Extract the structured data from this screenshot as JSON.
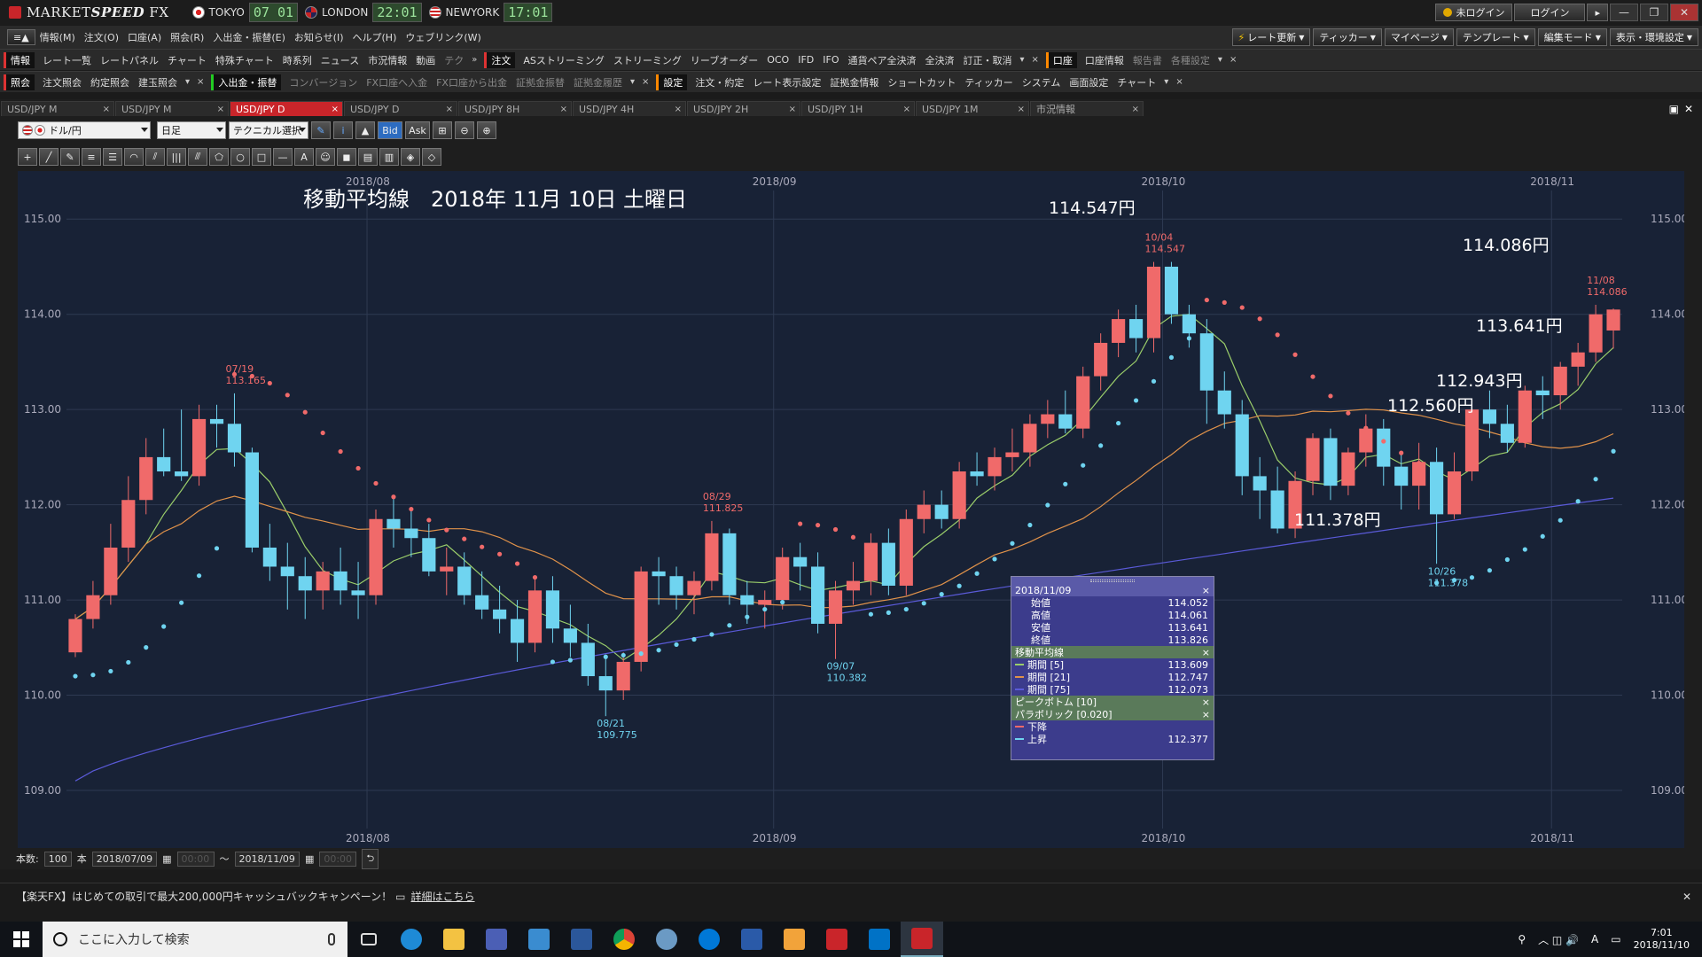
{
  "titlebar": {
    "app_name_prefix": "MARKET",
    "app_name_italic": "SPEED",
    "app_name_suffix": " FX",
    "clocks": [
      {
        "city": "TOKYO",
        "time": "07 01",
        "flag": "jp"
      },
      {
        "city": "LONDON",
        "time": "22:01",
        "flag": "uk"
      },
      {
        "city": "NEWYORK",
        "time": "17:01",
        "flag": "us"
      }
    ],
    "login_status": "未ログイン",
    "login_button": "ログイン",
    "next_arrow": "▸",
    "minimize": "—",
    "restore": "❐",
    "close": "✕"
  },
  "menubar": {
    "menu_icon": "≡▲",
    "items": [
      "情報(M)",
      "注文(O)",
      "口座(A)",
      "照会(R)",
      "入出金・振替(E)",
      "お知らせ(I)",
      "ヘルプ(H)",
      "ウェブリンク(W)"
    ],
    "right_buttons": [
      "レート更新",
      "ティッカー",
      "マイページ",
      "テンプレート",
      "編集モード",
      "表示・環境設定"
    ]
  },
  "toolrow1": {
    "info_label": "情報",
    "info_items": [
      "レート一覧",
      "レートパネル",
      "チャート",
      "特殊チャート",
      "時系列",
      "ニュース",
      "市況情報",
      "動画",
      "テク"
    ],
    "more_glyph": "»",
    "order_label": "注文",
    "order_items": [
      "ASストリーミング",
      "ストリーミング",
      "リーブオーダー",
      "OCO",
      "IFD",
      "IFO",
      "通貨ペア全決済",
      "全決済",
      "訂正・取消"
    ],
    "account_label": "口座",
    "account_items": [
      "口座情報",
      "報告書",
      "各種設定"
    ],
    "dropdown_glyph": "▾",
    "close_glyph": "×"
  },
  "toolrow2": {
    "inquiry_label": "照会",
    "inquiry_items": [
      "注文照会",
      "約定照会",
      "建玉照会"
    ],
    "transfer_label": "入出金・振替",
    "transfer_items": [
      "コンバージョン",
      "FX口座へ入金",
      "FX口座から出金",
      "証拠金振替",
      "証拠金履歴"
    ],
    "settings_label": "設定",
    "settings_items": [
      "注文・約定",
      "レート表示設定",
      "証拠金情報",
      "ショートカット",
      "ティッカー",
      "システム",
      "画面設定",
      "チャート"
    ],
    "dropdown_glyph": "▾",
    "close_glyph": "×"
  },
  "tabs": [
    {
      "label": "USD/JPY M",
      "active": false
    },
    {
      "label": "USD/JPY M",
      "active": false
    },
    {
      "label": "USD/JPY D",
      "active": true
    },
    {
      "label": "USD/JPY D",
      "active": false
    },
    {
      "label": "USD/JPY 8H",
      "active": false
    },
    {
      "label": "USD/JPY 4H",
      "active": false
    },
    {
      "label": "USD/JPY 2H",
      "active": false
    },
    {
      "label": "USD/JPY 1H",
      "active": false
    },
    {
      "label": "USD/JPY 1M",
      "active": false
    },
    {
      "label": "市況情報",
      "active": false
    }
  ],
  "tab_close": "×",
  "window_controls": {
    "maximize": "▣",
    "close": "✕"
  },
  "controls": {
    "pair": "ドル/円",
    "period": "日足",
    "technical": "テクニカル選択",
    "bid": "Bid",
    "ask": "Ask",
    "glyphs": {
      "pen": "✎",
      "info": "i",
      "mountain": "▲",
      "chart": "⊞",
      "zoom_out": "⊖",
      "zoom_in": "⊕"
    }
  },
  "drawing_tools": {
    "glyphs": [
      "+",
      "╱",
      "✎",
      "≡",
      "☰",
      "◠",
      "⫽",
      "|||",
      "⫻",
      "⬠",
      "○",
      "□",
      "—",
      "A",
      "☺",
      "◼",
      "▤",
      "▥",
      "◈",
      "◇"
    ]
  },
  "chart_overlay": {
    "title": "移動平均線　2018年 11月 10日 土曜日",
    "annotations": [
      "114.547円",
      "114.086円",
      "113.641円",
      "112.943円",
      "112.560円",
      "111.378円"
    ]
  },
  "chart_data": {
    "type": "candlestick",
    "symbol": "USD/JPY",
    "timeframe": "日足",
    "x_tick_labels": [
      "2018/08",
      "2018/09",
      "2018/10",
      "2018/11"
    ],
    "ylim": [
      108.6,
      115.3
    ],
    "y_ticks": [
      "115.00",
      "114.00",
      "113.00",
      "112.00",
      "111.00",
      "110.00",
      "109.00"
    ],
    "grid": true,
    "colors": {
      "up": "#f06a6a",
      "down": "#6fd4f0",
      "ma5": "#9acd6a",
      "ma21": "#e0924a",
      "ma75": "#5a5ad8",
      "sar_down": "#f06a6a",
      "sar_up": "#6fd4f0",
      "bg": "#182236"
    },
    "candles": [
      [
        110.45,
        110.85,
        110.4,
        110.8
      ],
      [
        110.8,
        111.2,
        110.7,
        111.05
      ],
      [
        111.05,
        111.8,
        110.95,
        111.55
      ],
      [
        111.55,
        112.3,
        111.4,
        112.05
      ],
      [
        112.05,
        112.7,
        111.9,
        112.5
      ],
      [
        112.5,
        112.8,
        112.3,
        112.35
      ],
      [
        112.35,
        113.0,
        112.25,
        112.3
      ],
      [
        112.3,
        113.05,
        112.2,
        112.9
      ],
      [
        112.9,
        113.05,
        112.6,
        112.85
      ],
      [
        112.85,
        113.17,
        112.4,
        112.55
      ],
      [
        112.55,
        112.6,
        111.5,
        111.55
      ],
      [
        111.55,
        111.8,
        111.2,
        111.35
      ],
      [
        111.35,
        111.6,
        110.9,
        111.25
      ],
      [
        111.25,
        111.45,
        110.8,
        111.1
      ],
      [
        111.1,
        111.4,
        110.9,
        111.3
      ],
      [
        111.3,
        111.55,
        110.95,
        111.1
      ],
      [
        111.1,
        111.4,
        110.8,
        111.05
      ],
      [
        111.05,
        111.95,
        110.95,
        111.85
      ],
      [
        111.85,
        112.1,
        111.55,
        111.75
      ],
      [
        111.75,
        111.95,
        111.45,
        111.65
      ],
      [
        111.65,
        111.8,
        111.25,
        111.3
      ],
      [
        111.3,
        111.55,
        111.05,
        111.35
      ],
      [
        111.35,
        111.5,
        110.95,
        111.05
      ],
      [
        111.05,
        111.3,
        110.8,
        110.9
      ],
      [
        110.9,
        111.15,
        110.65,
        110.8
      ],
      [
        110.8,
        111.0,
        110.35,
        110.55
      ],
      [
        110.55,
        111.25,
        110.45,
        111.1
      ],
      [
        111.1,
        111.25,
        110.55,
        110.7
      ],
      [
        110.7,
        110.95,
        110.4,
        110.55
      ],
      [
        110.55,
        110.75,
        110.1,
        110.2
      ],
      [
        110.2,
        110.4,
        109.78,
        110.05
      ],
      [
        110.05,
        110.45,
        109.95,
        110.35
      ],
      [
        110.35,
        111.35,
        110.25,
        111.3
      ],
      [
        111.3,
        111.45,
        110.95,
        111.25
      ],
      [
        111.25,
        111.35,
        110.9,
        111.05
      ],
      [
        111.05,
        111.3,
        110.85,
        111.2
      ],
      [
        111.2,
        111.83,
        111.1,
        111.7
      ],
      [
        111.7,
        111.75,
        110.95,
        111.05
      ],
      [
        111.05,
        111.2,
        110.75,
        110.95
      ],
      [
        110.95,
        111.1,
        110.7,
        111.0
      ],
      [
        111.0,
        111.55,
        110.9,
        111.45
      ],
      [
        111.45,
        111.6,
        111.1,
        111.35
      ],
      [
        111.35,
        111.5,
        110.65,
        110.75
      ],
      [
        110.75,
        111.2,
        110.38,
        111.1
      ],
      [
        111.1,
        111.4,
        110.95,
        111.2
      ],
      [
        111.2,
        111.7,
        111.05,
        111.6
      ],
      [
        111.6,
        111.75,
        111.05,
        111.15
      ],
      [
        111.15,
        111.95,
        111.05,
        111.85
      ],
      [
        111.85,
        112.15,
        111.7,
        112.0
      ],
      [
        112.0,
        112.15,
        111.75,
        111.85
      ],
      [
        111.85,
        112.45,
        111.75,
        112.35
      ],
      [
        112.35,
        112.55,
        112.2,
        112.3
      ],
      [
        112.3,
        112.6,
        112.15,
        112.5
      ],
      [
        112.5,
        112.8,
        112.35,
        112.55
      ],
      [
        112.55,
        112.95,
        112.4,
        112.85
      ],
      [
        112.85,
        113.1,
        112.7,
        112.95
      ],
      [
        112.95,
        113.2,
        112.75,
        112.8
      ],
      [
        112.8,
        113.45,
        112.7,
        113.35
      ],
      [
        113.35,
        113.8,
        113.2,
        113.7
      ],
      [
        113.7,
        114.05,
        113.55,
        113.95
      ],
      [
        113.95,
        114.1,
        113.6,
        113.75
      ],
      [
        113.75,
        114.55,
        113.6,
        114.5
      ],
      [
        114.5,
        114.55,
        113.9,
        114.0
      ],
      [
        114.0,
        114.1,
        113.65,
        113.8
      ],
      [
        113.8,
        113.95,
        112.85,
        113.2
      ],
      [
        113.2,
        113.4,
        112.8,
        112.95
      ],
      [
        112.95,
        113.1,
        112.1,
        112.3
      ],
      [
        112.3,
        112.5,
        111.85,
        112.15
      ],
      [
        112.15,
        112.4,
        111.7,
        111.75
      ],
      [
        111.75,
        112.35,
        111.65,
        112.25
      ],
      [
        112.25,
        112.75,
        112.1,
        112.7
      ],
      [
        112.7,
        112.8,
        112.05,
        112.2
      ],
      [
        112.2,
        112.6,
        112.1,
        112.55
      ],
      [
        112.55,
        112.95,
        112.4,
        112.8
      ],
      [
        112.8,
        112.9,
        112.2,
        112.4
      ],
      [
        112.4,
        112.55,
        111.95,
        112.2
      ],
      [
        112.2,
        112.65,
        111.95,
        112.45
      ],
      [
        112.45,
        112.6,
        111.38,
        111.9
      ],
      [
        111.9,
        112.55,
        111.85,
        112.35
      ],
      [
        112.35,
        113.1,
        112.25,
        113.0
      ],
      [
        113.0,
        113.2,
        112.7,
        112.85
      ],
      [
        112.85,
        113.05,
        112.55,
        112.65
      ],
      [
        112.65,
        113.25,
        112.6,
        113.2
      ],
      [
        113.2,
        113.35,
        112.9,
        113.15
      ],
      [
        113.15,
        113.5,
        113.0,
        113.45
      ],
      [
        113.45,
        113.7,
        113.25,
        113.6
      ],
      [
        113.6,
        114.1,
        113.5,
        114.0
      ],
      [
        113.83,
        114.06,
        113.64,
        114.05
      ]
    ],
    "data_labels": [
      {
        "date": "07/19",
        "price": "113.165"
      },
      {
        "date": "08/21",
        "price": "109.775"
      },
      {
        "date": "08/29",
        "price": "111.825"
      },
      {
        "date": "09/07",
        "price": "110.382"
      },
      {
        "date": "10/04",
        "price": "114.547"
      },
      {
        "date": "10/26",
        "price": "111.378"
      },
      {
        "date": "11/08",
        "price": "114.086"
      }
    ]
  },
  "info_panel": {
    "date": "2018/11/09",
    "ohlc": [
      {
        "k": "始値",
        "v": "114.052"
      },
      {
        "k": "高値",
        "v": "114.061"
      },
      {
        "k": "安値",
        "v": "113.641"
      },
      {
        "k": "終値",
        "v": "113.826"
      }
    ],
    "ma_title": "移動平均線",
    "ma": [
      {
        "k": "期間 [5]",
        "v": "113.609",
        "color": "#9acd6a"
      },
      {
        "k": "期間 [21]",
        "v": "112.747",
        "color": "#e0924a"
      },
      {
        "k": "期間 [75]",
        "v": "112.073",
        "color": "#5a5ad8"
      }
    ],
    "pb_title": "ピークボトム [10]",
    "sar_title": "パラボリック [0.020]",
    "sar": [
      {
        "k": "下降",
        "v": "",
        "color": "#f06a6a"
      },
      {
        "k": "上昇",
        "v": "112.377",
        "color": "#6fd4f0"
      }
    ],
    "close_glyph": "×"
  },
  "bottom": {
    "count_label": "本数:",
    "count_value": "100",
    "count_unit": "本",
    "from_date": "2018/07/09",
    "from_time": "00:00",
    "tilde": "〜",
    "to_date": "2018/11/09",
    "to_time": "00:00",
    "return_glyph": "⮌"
  },
  "banner": {
    "text": "【楽天FX】はじめての取引で最大200,000円キャッシュバックキャンペーン！",
    "link": "詳細はこちら",
    "close": "✕"
  },
  "taskbar": {
    "search_placeholder": "ここに入力して検索",
    "time": "7:01",
    "date": "2018/11/10",
    "ime": "A",
    "person_glyph": "⚲",
    "tray_glyphs": "︿ ◫ 🔊"
  }
}
